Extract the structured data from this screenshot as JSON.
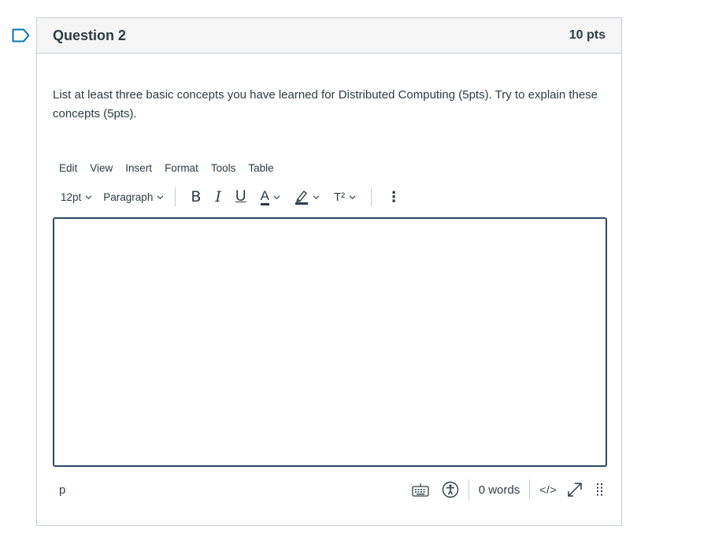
{
  "question": {
    "title": "Question 2",
    "points": "10 pts",
    "text": "List at least three basic concepts you have learned for Distributed Computing (5pts). Try to explain these concepts (5pts)."
  },
  "menubar": [
    "Edit",
    "View",
    "Insert",
    "Format",
    "Tools",
    "Table"
  ],
  "toolbar": {
    "font_size": "12pt",
    "block_format": "Paragraph",
    "bold": "B",
    "italic": "I",
    "underline": "U",
    "text_color": "A",
    "superscript": "T²",
    "more": "⋮"
  },
  "editor": {
    "content": ""
  },
  "statusbar": {
    "path": "p",
    "word_count": "0 words",
    "html_toggle": "</>"
  },
  "colors": {
    "accent": "#2b4a66",
    "border": "#c7cdd1",
    "flag": "#0374b5",
    "text": "#2d3b45",
    "header_bg": "#f5f5f5"
  }
}
